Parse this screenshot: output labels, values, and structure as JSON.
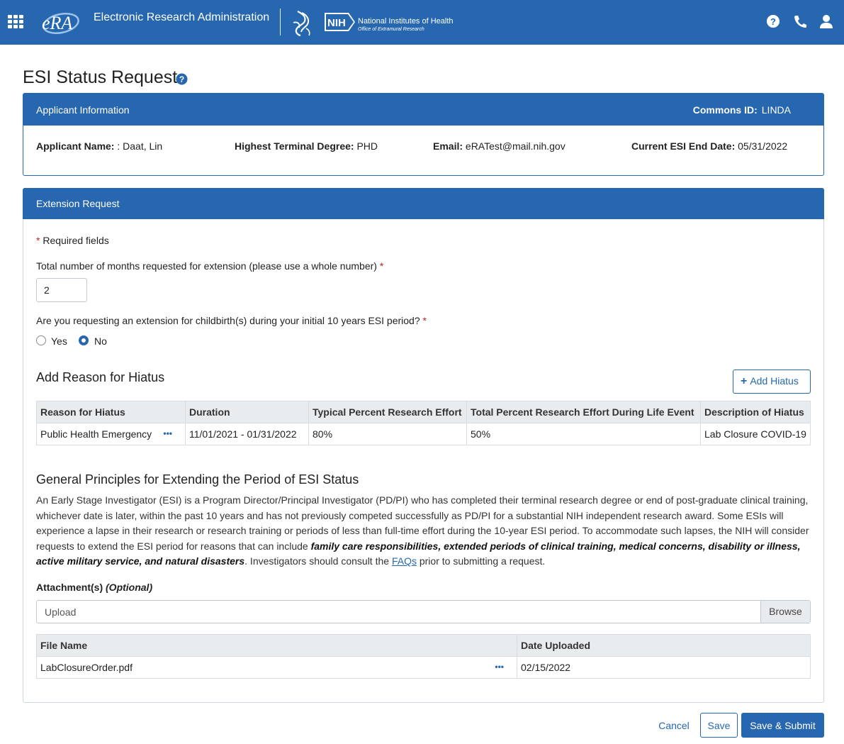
{
  "header": {
    "app_name": "Electronic Research Administration",
    "era_logo_text": "eRA",
    "nih_logo_text": "NIH",
    "nih_name": "National Institutes of Health",
    "nih_sub": "Office of Extramural Research",
    "brand_color": "#2767b0"
  },
  "page": {
    "title": "ESI Status Request"
  },
  "applicant": {
    "section_label": "Applicant Information",
    "commons_id_label": "Commons ID:",
    "commons_id_value": "LINDA",
    "name_label": "Applicant Name:",
    "name_value": ": Daat,  Lin",
    "degree_label": "Highest Terminal Degree:",
    "degree_value": "PHD",
    "email_label": "Email:",
    "email_value": "eRATest@mail.nih.gov",
    "esi_end_label": "Current ESI End Date:",
    "esi_end_value": "05/31/2022"
  },
  "extension": {
    "section_label": "Extension Request",
    "required_note": "Required fields",
    "months_question": "Total number of months requested for extension (please use a whole number)",
    "months_value": "2",
    "childbirth_question": "Are you requesting an extension for childbirth(s) during your initial 10 years ESI period?",
    "yes_label": "Yes",
    "no_label": "No",
    "selected": "No"
  },
  "hiatus": {
    "title": "Add Reason for Hiatus",
    "add_button": "Add Hiatus",
    "columns": [
      "Reason for Hiatus",
      "Duration",
      "Typical Percent Research Effort",
      "Total Percent Research Effort During Life Event",
      "Description of Hiatus"
    ],
    "rows": [
      {
        "reason": "Public Health Emergency",
        "duration": "11/01/2021 - 01/31/2022",
        "typical": "80%",
        "total": "50%",
        "description": "Lab Closure COVID-19"
      }
    ]
  },
  "principles": {
    "title": "General Principles for Extending the Period of ESI Status",
    "text_1": "An Early Stage Investigator (ESI) is a Program Director/Principal Investigator (PD/PI) who has completed their terminal research degree or end of post-graduate clinical training, whichever date is later, within the past 10 years and has not previously competed successfully as PD/PI for a substantial NIH independent research award. Some ESIs will experience a lapse in their research or research training or periods of less than full-time effort during the 10-year ESI period. To accommodate such lapses, the NIH will consider requests to extend the ESI period for reasons that can include ",
    "text_bold": "family care responsibilities, extended periods of clinical training, medical concerns, disability or illness, active military service, and natural disasters",
    "text_2": ". Investigators should consult the ",
    "faq_link": "FAQs",
    "text_3": " prior to submitting a request."
  },
  "attachments": {
    "label": "Attachment(s)",
    "optional": "(Optional)",
    "upload_placeholder": "Upload",
    "browse_label": "Browse",
    "columns": [
      "File Name",
      "Date Uploaded"
    ],
    "rows": [
      {
        "file": "LabClosureOrder.pdf",
        "date": "02/15/2022"
      }
    ]
  },
  "actions": {
    "cancel": "Cancel",
    "save": "Save",
    "submit": "Save & Submit"
  },
  "icons": {
    "menu": "grid-menu-icon",
    "help": "help-circle-icon",
    "phone": "phone-icon",
    "user": "user-icon",
    "more": "ellipsis-icon"
  }
}
